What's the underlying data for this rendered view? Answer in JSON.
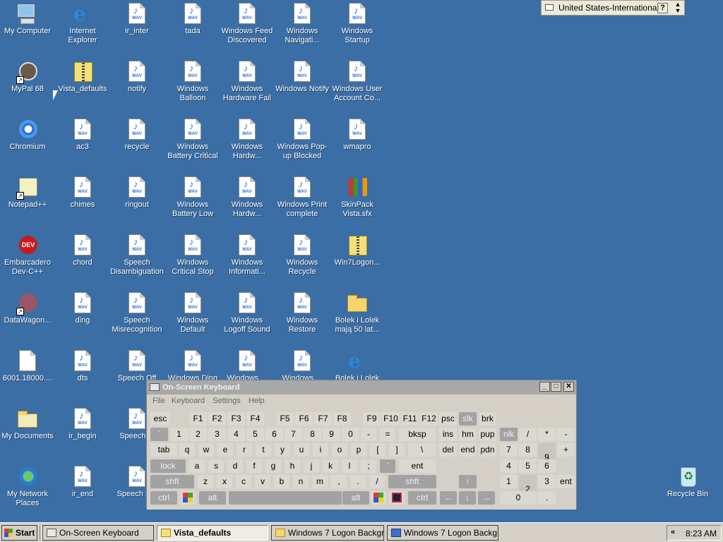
{
  "desktop": {
    "icons": [
      {
        "label": "My Computer",
        "icon": "my-computer-icon"
      },
      {
        "label": "Internet Explorer",
        "icon": "internet-explorer-icon"
      },
      {
        "label": "ir_inter",
        "icon": "wav-file-icon"
      },
      {
        "label": "tada",
        "icon": "wav-file-icon"
      },
      {
        "label": "Windows Feed Discovered",
        "icon": "wav-file-icon"
      },
      {
        "label": "Windows Navigati...",
        "icon": "wav-file-icon"
      },
      {
        "label": "Windows Startup",
        "icon": "wav-file-icon"
      },
      {
        "label": "MyPal 68",
        "icon": "mypal-raccoon-shortcut-icon"
      },
      {
        "label": "Vista_defaults",
        "icon": "zip-folder-icon"
      },
      {
        "label": "notify",
        "icon": "wav-file-icon"
      },
      {
        "label": "Windows Balloon",
        "icon": "wav-file-icon"
      },
      {
        "label": "Windows Hardware Fail",
        "icon": "wav-file-icon"
      },
      {
        "label": "Windows Notify",
        "icon": "wav-file-icon"
      },
      {
        "label": "Windows User Account Co...",
        "icon": "wav-file-icon"
      },
      {
        "label": "Chromium",
        "icon": "chromium-icon"
      },
      {
        "label": "ac3",
        "icon": "wav-file-icon"
      },
      {
        "label": "recycle",
        "icon": "wav-file-icon"
      },
      {
        "label": "Windows Battery Critical",
        "icon": "wav-file-icon"
      },
      {
        "label": "Windows Hardw...",
        "icon": "wav-file-icon"
      },
      {
        "label": "Windows Pop-up Blocked",
        "icon": "wav-file-icon"
      },
      {
        "label": "wmapro",
        "icon": "wav-file-icon"
      },
      {
        "label": "Notepad++",
        "icon": "notepad-plus-plus-shortcut-icon"
      },
      {
        "label": "chimes",
        "icon": "wav-file-icon"
      },
      {
        "label": "ringout",
        "icon": "wav-file-icon"
      },
      {
        "label": "Windows Battery Low",
        "icon": "wav-file-icon"
      },
      {
        "label": "Windows Hardw...",
        "icon": "wav-file-icon"
      },
      {
        "label": "Windows Print complete",
        "icon": "wav-file-icon"
      },
      {
        "label": "SkinPack Vista.sfx",
        "icon": "skinpack-archive-icon"
      },
      {
        "label": "Embarcadero Dev-C++",
        "icon": "dev-cpp-icon"
      },
      {
        "label": "chord",
        "icon": "wav-file-icon"
      },
      {
        "label": "Speech Disambiguation",
        "icon": "wav-file-icon"
      },
      {
        "label": "Windows Critical Stop",
        "icon": "wav-file-icon"
      },
      {
        "label": "Windows Informati...",
        "icon": "wav-file-icon"
      },
      {
        "label": "Windows Recycle",
        "icon": "wav-file-icon"
      },
      {
        "label": "Win7Logon...",
        "icon": "zip-folder-icon"
      },
      {
        "label": "DataWagon...",
        "icon": "datawagon-shortcut-icon"
      },
      {
        "label": "ding",
        "icon": "wav-file-icon"
      },
      {
        "label": "Speech Misrecognition",
        "icon": "wav-file-icon"
      },
      {
        "label": "Windows Default",
        "icon": "wav-file-icon"
      },
      {
        "label": "Windows Logoff Sound",
        "icon": "wav-file-icon"
      },
      {
        "label": "Windows Restore",
        "icon": "wav-file-icon"
      },
      {
        "label": "Bolek i Lolek mają 50 lat...",
        "icon": "folder-icon"
      },
      {
        "label": "6001.18000....",
        "icon": "file-icon"
      },
      {
        "label": "dts",
        "icon": "wav-file-icon"
      },
      {
        "label": "Speech Off",
        "icon": "wav-file-icon"
      },
      {
        "label": "Windows Ding",
        "icon": "wav-file-icon"
      },
      {
        "label": "Windows ...",
        "icon": "wav-file-icon"
      },
      {
        "label": "Windows ...",
        "icon": "wav-file-icon"
      },
      {
        "label": "Bolek i Lolek",
        "icon": "internet-explorer-icon"
      },
      {
        "label": "My Documents",
        "icon": "my-documents-icon"
      },
      {
        "label": "ir_begin",
        "icon": "wav-file-icon"
      },
      {
        "label": "Speech ...",
        "icon": "wav-file-icon"
      },
      {
        "label": "My Network Places",
        "icon": "my-network-places-icon"
      },
      {
        "label": "ir_end",
        "icon": "wav-file-icon"
      },
      {
        "label": "Speech S...",
        "icon": "wav-file-icon"
      },
      {
        "label": "Recycle Bin",
        "icon": "recycle-bin-icon"
      }
    ],
    "wav_text": "WAV"
  },
  "langbar": {
    "language": "United States-International",
    "help": "?"
  },
  "osk": {
    "title": "On-Screen Keyboard",
    "menu": [
      "File",
      "Keyboard",
      "Settings",
      "Help"
    ],
    "keys": [
      {
        "l": "esc"
      },
      {
        "l": "F1"
      },
      {
        "l": "F2"
      },
      {
        "l": "F3"
      },
      {
        "l": "F4"
      },
      {
        "l": "F5"
      },
      {
        "l": "F6"
      },
      {
        "l": "F7"
      },
      {
        "l": "F8"
      },
      {
        "l": "F9"
      },
      {
        "l": "F10"
      },
      {
        "l": "F11"
      },
      {
        "l": "F12"
      },
      {
        "l": "psc"
      },
      {
        "l": "slk",
        "dark": true
      },
      {
        "l": "brk"
      },
      {
        "l": "`",
        "dark": true
      },
      {
        "l": "1"
      },
      {
        "l": "2"
      },
      {
        "l": "3"
      },
      {
        "l": "4"
      },
      {
        "l": "5"
      },
      {
        "l": "6"
      },
      {
        "l": "7"
      },
      {
        "l": "8"
      },
      {
        "l": "9"
      },
      {
        "l": "0"
      },
      {
        "l": "-"
      },
      {
        "l": "="
      },
      {
        "l": "bksp"
      },
      {
        "l": "ins"
      },
      {
        "l": "hm"
      },
      {
        "l": "pup"
      },
      {
        "l": "nlk",
        "dark": true
      },
      {
        "l": "/"
      },
      {
        "l": "*"
      },
      {
        "l": "-"
      },
      {
        "l": "tab"
      },
      {
        "l": "q"
      },
      {
        "l": "w"
      },
      {
        "l": "e"
      },
      {
        "l": "r"
      },
      {
        "l": "t"
      },
      {
        "l": "y"
      },
      {
        "l": "u"
      },
      {
        "l": "i"
      },
      {
        "l": "o"
      },
      {
        "l": "p"
      },
      {
        "l": "["
      },
      {
        "l": "]"
      },
      {
        "l": "\\"
      },
      {
        "l": "del"
      },
      {
        "l": "end"
      },
      {
        "l": "pdn"
      },
      {
        "l": "7"
      },
      {
        "l": "8"
      },
      {
        "l": "9"
      },
      {
        "l": "+"
      },
      {
        "l": "lock",
        "dark": true
      },
      {
        "l": "a"
      },
      {
        "l": "s"
      },
      {
        "l": "d"
      },
      {
        "l": "f"
      },
      {
        "l": "g"
      },
      {
        "l": "h"
      },
      {
        "l": "j"
      },
      {
        "l": "k"
      },
      {
        "l": "l"
      },
      {
        "l": ";"
      },
      {
        "l": "'",
        "dark": true
      },
      {
        "l": "ent"
      },
      {
        "l": "4"
      },
      {
        "l": "5"
      },
      {
        "l": "6"
      },
      {
        "l": "shft",
        "dark": true
      },
      {
        "l": "z"
      },
      {
        "l": "x"
      },
      {
        "l": "c"
      },
      {
        "l": "v"
      },
      {
        "l": "b"
      },
      {
        "l": "n"
      },
      {
        "l": "m"
      },
      {
        "l": ","
      },
      {
        "l": "."
      },
      {
        "l": "/"
      },
      {
        "l": "shft",
        "dark": true
      },
      {
        "l": "↑",
        "dark": true
      },
      {
        "l": "1"
      },
      {
        "l": "2"
      },
      {
        "l": "3"
      },
      {
        "l": "ent"
      },
      {
        "l": "ctrl",
        "dark": true
      },
      {
        "l": "",
        "win": true
      },
      {
        "l": "alt",
        "dark": true
      },
      {
        "l": "",
        "dark": true
      },
      {
        "l": "alt",
        "dark": true
      },
      {
        "l": "",
        "win": true
      },
      {
        "l": "",
        "menu": true
      },
      {
        "l": "ctrl",
        "dark": true
      },
      {
        "l": "←",
        "dark": true
      },
      {
        "l": "↓",
        "dark": true
      },
      {
        "l": "→",
        "dark": true
      },
      {
        "l": "0"
      },
      {
        "l": "."
      }
    ]
  },
  "taskbar": {
    "start": "Start",
    "tasks": [
      {
        "label": "On-Screen Keyboard",
        "icon": "keyboard-icon",
        "active": false
      },
      {
        "label": "Vista_defaults",
        "icon": "zip-folder-icon",
        "active": true
      },
      {
        "label": "Windows 7 Logon Backgr...",
        "icon": "folder-icon",
        "active": false
      },
      {
        "label": "Windows 7 Logon Backgr...",
        "icon": "app-icon",
        "active": false
      }
    ],
    "chevron": "«",
    "clock": "8:23 AM"
  }
}
